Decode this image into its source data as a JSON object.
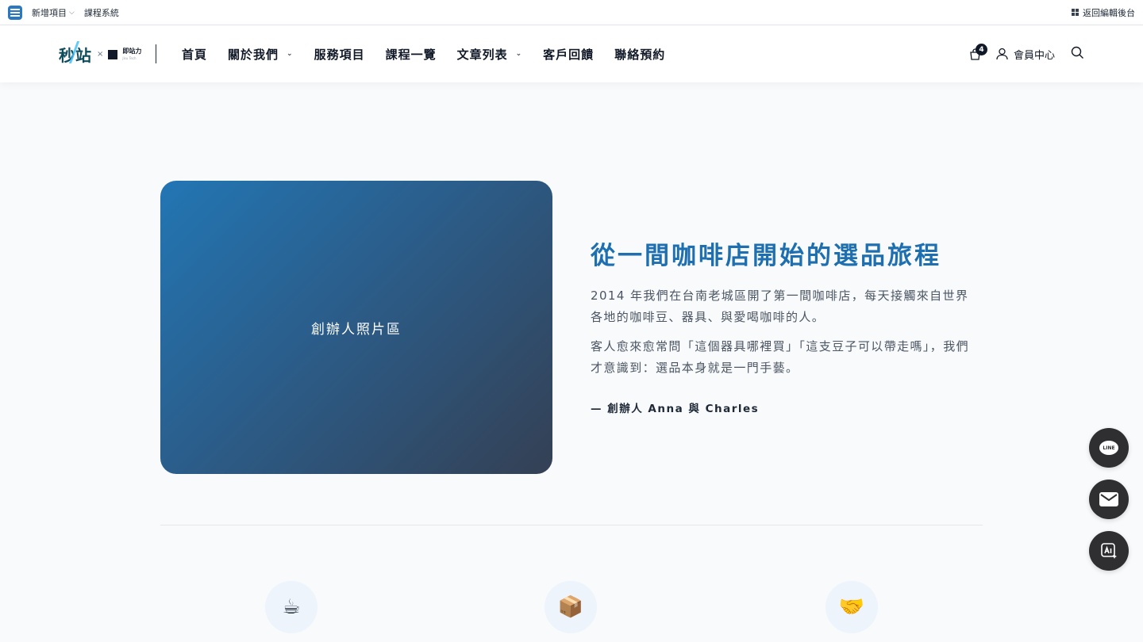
{
  "adminbar": {
    "new_item": "新增項目",
    "course_system": "課程系統",
    "back_to_admin": "返回編輯後台"
  },
  "brand": {
    "name": "秒站",
    "times": "×",
    "partner": "即站力",
    "partner_sub": "Jisu Tech"
  },
  "nav": {
    "home": "首頁",
    "about": "關於我們",
    "services": "服務項目",
    "courses": "課程一覽",
    "articles": "文章列表",
    "testimonials": "客戶回饋",
    "contact": "聯絡預約"
  },
  "header_tools": {
    "cart_count": "4",
    "member_center": "會員中心"
  },
  "hero": {
    "photo_placeholder": "創辦人照片區",
    "title": "從一間咖啡店開始的選品旅程",
    "paragraph1": "2014 年我們在台南老城區開了第一間咖啡店，每天接觸來自世界各地的咖啡豆、器具、與愛喝咖啡的人。",
    "paragraph2": "客人愈來愈常問「這個器具哪裡買」「這支豆子可以帶走嗎」，我們才意識到：選品本身就是一門手藝。",
    "signature": "— 創辦人 Anna 與 Charles"
  },
  "features": [
    {
      "icon": "☕"
    },
    {
      "icon": "📦"
    },
    {
      "icon": "🤝"
    }
  ],
  "floating": {
    "line_label": "LINE"
  },
  "colors": {
    "accent": "#1e6fb0",
    "photo_gradient_start": "#2276b4",
    "photo_gradient_end": "#344054",
    "fab": "#2f2f31"
  }
}
